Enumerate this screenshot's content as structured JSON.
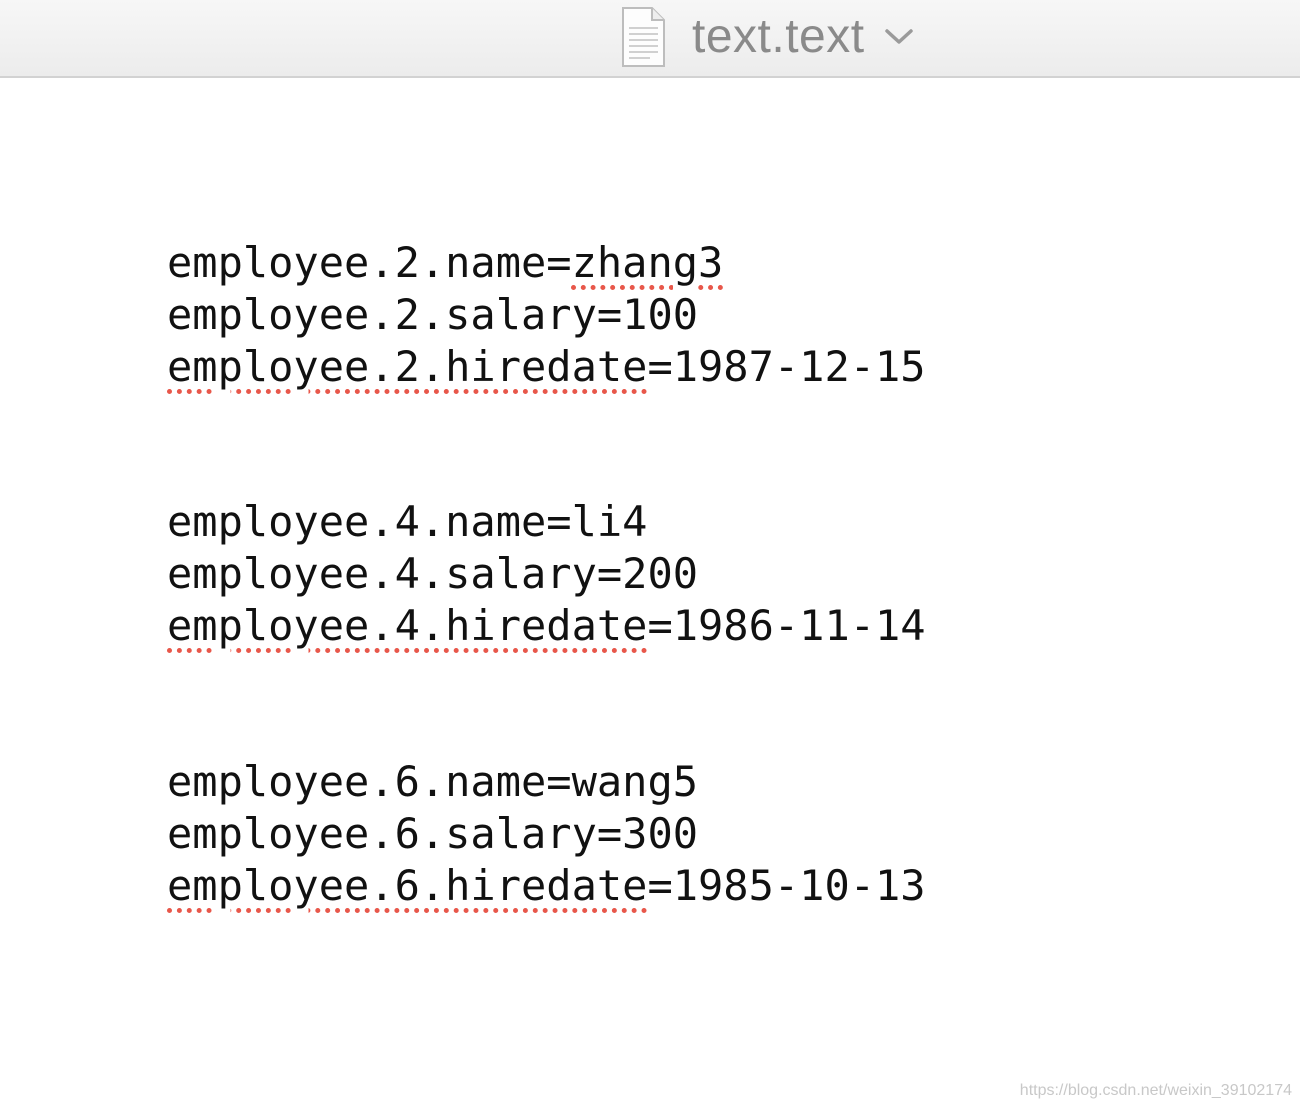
{
  "window": {
    "title": "text.text",
    "title_icon": "document-icon",
    "title_menu_icon": "chevron-down-icon"
  },
  "editor": {
    "blocks": [
      {
        "lines": [
          {
            "key": "employee.2.name",
            "sep": "=",
            "value": "zhang3"
          },
          {
            "key": "employee.2.salary",
            "sep": "=",
            "value": "100"
          },
          {
            "key": "employee.2.hiredate",
            "sep": "=",
            "value": "1987-12-15"
          }
        ]
      },
      {
        "lines": [
          {
            "key": "employee.4.name",
            "sep": "=",
            "value": "li4"
          },
          {
            "key": "employee.4.salary",
            "sep": "=",
            "value": "200"
          },
          {
            "key": "employee.4.hiredate",
            "sep": "=",
            "value": "1986-11-14"
          }
        ]
      },
      {
        "lines": [
          {
            "key": "employee.6.name",
            "sep": "=",
            "value": "wang5"
          },
          {
            "key": "employee.6.salary",
            "sep": "=",
            "value": "300"
          },
          {
            "key": "employee.6.hiredate",
            "sep": "=",
            "value": "1985-10-13"
          }
        ]
      }
    ]
  },
  "watermark": "https://blog.csdn.net/weixin_39102174",
  "colors": {
    "spellcheck_underline": "#e8574a",
    "title_text": "#8a8a8a",
    "text": "#111111"
  }
}
